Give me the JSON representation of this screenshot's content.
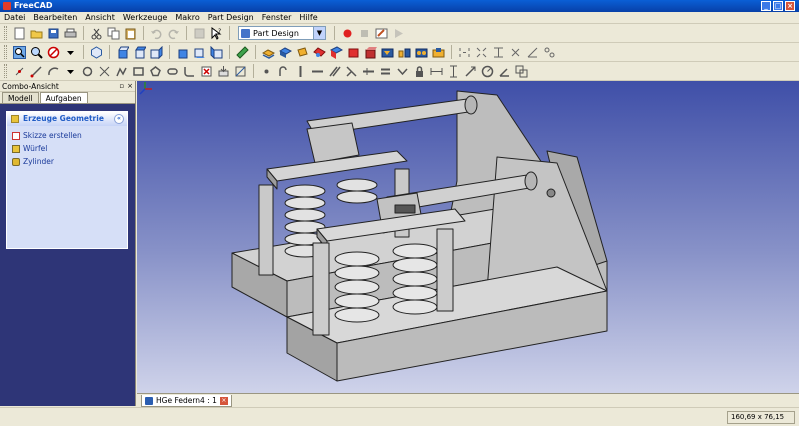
{
  "window": {
    "title": "FreeCAD",
    "buttons": [
      "_",
      "□",
      "×"
    ]
  },
  "menu": [
    "Datei",
    "Bearbeiten",
    "Ansicht",
    "Werkzeuge",
    "Makro",
    "Part Design",
    "Fenster",
    "Hilfe"
  ],
  "workbench_selector": {
    "value": "Part Design"
  },
  "combo": {
    "title": "Combo-Ansicht",
    "header_buttons": [
      "▫",
      "×"
    ],
    "tabs": [
      "Modell",
      "Aufgaben"
    ],
    "task_box": {
      "title": "Erzeuge Geometrie",
      "collapse_glyph": "«",
      "items": [
        "Skizze erstellen",
        "Würfel",
        "Zylinder"
      ]
    }
  },
  "document_tab": {
    "label": "HGe Federn4 : 1",
    "close_glyph": "×"
  },
  "status": {
    "coords": "160,69 x 76,15 mm"
  },
  "colors": {
    "accent": "#215dc6",
    "viewport_top": "#3f4fa8",
    "viewport_bottom": "#cfd3ea",
    "model_gray": "#c8c8c8"
  },
  "icons": {
    "toolbar1": [
      "new-icon",
      "open-icon",
      "save-icon",
      "print-icon",
      "cut-icon",
      "copy-icon",
      "paste-icon",
      "undo-icon",
      "redo-icon",
      "refresh-icon",
      "whats-this-icon",
      "record-macro-icon",
      "stop-macro-icon",
      "edit-macro-icon",
      "run-macro-icon"
    ],
    "toolbar2": [
      "zoom-fit-icon",
      "zoom-selection-icon",
      "draw-style-icon",
      "isometric-icon",
      "front-icon",
      "top-icon",
      "right-icon",
      "rear-icon",
      "bottom-icon",
      "left-icon",
      "measure-icon",
      "pad-icon",
      "pocket-icon",
      "revolve-icon",
      "groove-icon",
      "fillet-icon",
      "chamfer-icon",
      "draft-icon",
      "mirror-icon",
      "linear-pattern-icon",
      "polar-pattern-icon",
      "multi-transform-icon"
    ],
    "toolbar3": [
      "point-icon",
      "line-icon",
      "arc-icon",
      "circle-icon",
      "ellipse-icon",
      "polyline-icon",
      "rectangle-icon",
      "polygon-icon",
      "slot-icon",
      "fillet-sketch-icon",
      "trim-icon",
      "external-icon",
      "construction-icon",
      "coincident-icon",
      "point-on-object-icon",
      "vertical-icon",
      "horizontal-icon",
      "parallel-icon",
      "perpendicular-icon",
      "tangent-icon",
      "equal-icon",
      "symmetric-icon",
      "lock-icon",
      "horizontal-distance-icon",
      "vertical-distance-icon",
      "length-icon",
      "radius-icon",
      "angle-icon",
      "snell-icon",
      "internal-alignment-icon"
    ]
  }
}
